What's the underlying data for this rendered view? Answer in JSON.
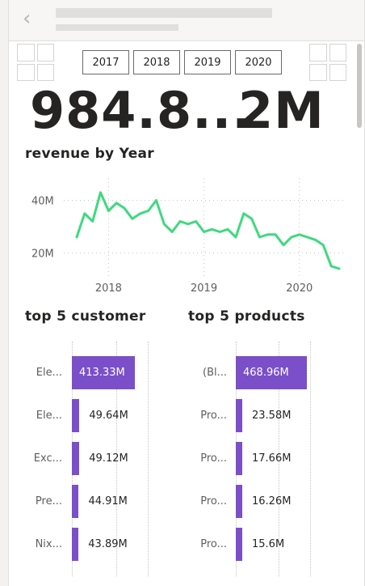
{
  "kpis": {
    "revenue_value": "984.8...",
    "count_value": "2M"
  },
  "slicer": {
    "years": [
      "2017",
      "2018",
      "2019",
      "2020"
    ]
  },
  "line_chart": {
    "title": "revenue by Year",
    "y_ticks": [
      "40M",
      "20M"
    ],
    "x_ticks": [
      "2018",
      "2019",
      "2020"
    ],
    "color": "#3fd97f"
  },
  "top_customers": {
    "title": "top 5 customer",
    "labels": [
      "Ele...",
      "Ele...",
      "Exc...",
      "Pre...",
      "Nix..."
    ],
    "value_labels": [
      "413.33M",
      "49.64M",
      "49.12M",
      "44.91M",
      "43.89M"
    ],
    "values": [
      413.33,
      49.64,
      49.12,
      44.91,
      43.89
    ]
  },
  "top_products": {
    "title": "top 5 products",
    "labels": [
      "(Bl...",
      "Pro...",
      "Pro...",
      "Pro...",
      "Pro..."
    ],
    "value_labels": [
      "468.96M",
      "23.58M",
      "17.66M",
      "16.26M",
      "15.6M"
    ],
    "values": [
      468.96,
      23.58,
      17.66,
      16.26,
      15.6
    ]
  },
  "colors": {
    "bar": "#7b4fc9",
    "line": "#3fd97f"
  },
  "chart_data": [
    {
      "type": "line",
      "title": "revenue by Year",
      "xlabel": "",
      "ylabel": "",
      "x_ticks": [
        "2018",
        "2019",
        "2020"
      ],
      "ylim": [
        10,
        50
      ],
      "y_ticks": [
        20,
        40
      ],
      "series": [
        {
          "x": [
            "2017-09",
            "2017-10",
            "2017-11",
            "2017-12",
            "2018-01",
            "2018-02",
            "2018-03",
            "2018-04",
            "2018-05",
            "2018-06",
            "2018-07",
            "2018-08",
            "2018-09",
            "2018-10",
            "2018-11",
            "2018-12",
            "2019-01",
            "2019-02",
            "2019-03",
            "2019-04",
            "2019-05",
            "2019-06",
            "2019-07",
            "2019-08",
            "2019-09",
            "2019-10",
            "2019-11",
            "2019-12",
            "2020-01",
            "2020-02",
            "2020-03",
            "2020-04",
            "2020-05",
            "2020-06"
          ],
          "values": [
            26,
            35,
            32,
            43,
            36,
            39,
            37,
            33,
            35,
            36,
            40,
            31,
            28,
            32,
            31,
            32,
            28,
            29,
            28,
            29,
            26,
            35,
            33,
            26,
            27,
            27,
            23,
            26,
            27,
            26,
            25,
            23,
            15,
            14
          ]
        }
      ]
    },
    {
      "type": "bar",
      "orientation": "horizontal",
      "title": "top 5 customer",
      "categories": [
        "Ele...",
        "Ele...",
        "Exc...",
        "Pre...",
        "Nix..."
      ],
      "values": [
        413.33,
        49.64,
        49.12,
        44.91,
        43.89
      ]
    },
    {
      "type": "bar",
      "orientation": "horizontal",
      "title": "top 5 products",
      "categories": [
        "(Bl...",
        "Pro...",
        "Pro...",
        "Pro...",
        "Pro..."
      ],
      "values": [
        468.96,
        23.58,
        17.66,
        16.26,
        15.6
      ]
    }
  ]
}
